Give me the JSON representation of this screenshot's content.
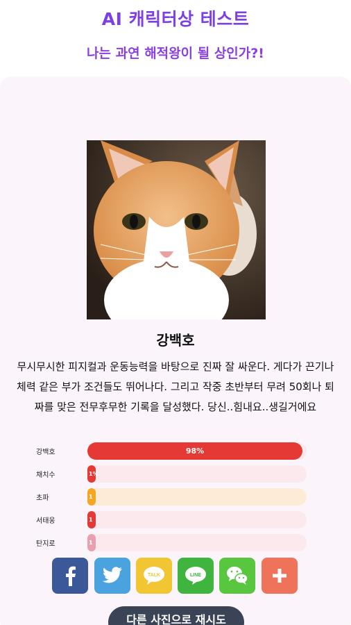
{
  "header": {
    "title": "AI 캐릭터상 테스트",
    "subtitle": "나는 과연 해적왕이 될 상인가?!"
  },
  "result": {
    "name": "강백호",
    "description": "무시무시한 피지컬과 운동능력을 바탕으로 진짜 잘 싸운다. 게다가 끈기나 체력 같은 부가 조건들도 뛰어나다. 그리고 작중 초반부터 무려 50회나 퇴짜를 맞은 전무후무한 기록을 달성했다. 당신..힘내요..생길거에요"
  },
  "scores": [
    {
      "label": "강백호",
      "percent": 98,
      "percent_text": "98%",
      "color": "#e53935",
      "track": "#fbe9ee"
    },
    {
      "label": "채치수",
      "percent": 1,
      "percent_text": "1%",
      "color": "#e53935",
      "track": "#fbe9ee"
    },
    {
      "label": "초파",
      "percent": 1,
      "percent_text": "1",
      "color": "#f5a623",
      "track": "#fdebd6"
    },
    {
      "label": "서태웅",
      "percent": 1,
      "percent_text": "1",
      "color": "#e53935",
      "track": "#fbe9ee"
    },
    {
      "label": "탄지로",
      "percent": 1,
      "percent_text": "1",
      "color": "#e8a0b0",
      "track": "#fbe9ee"
    }
  ],
  "share": [
    {
      "name": "facebook",
      "icon": "facebook-icon",
      "color": "#3b5998"
    },
    {
      "name": "twitter",
      "icon": "twitter-icon",
      "color": "#4aa3df"
    },
    {
      "name": "kakaotalk",
      "icon": "kakaotalk-icon",
      "color": "#f2c533",
      "text": "TALK"
    },
    {
      "name": "line",
      "icon": "line-icon",
      "color": "#3fb53f",
      "text": "LINE"
    },
    {
      "name": "wechat",
      "icon": "wechat-icon",
      "color": "#58c63e"
    },
    {
      "name": "more",
      "icon": "plus-icon",
      "color": "#ee735a"
    }
  ],
  "retry_label": "다른 사진으로 재시도"
}
